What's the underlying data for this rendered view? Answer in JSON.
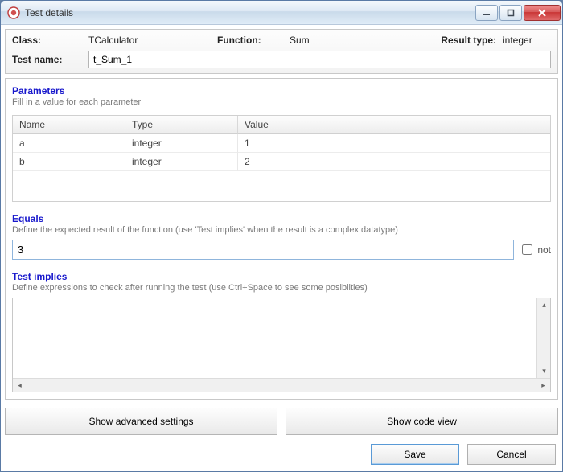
{
  "window": {
    "title": "Test details"
  },
  "header": {
    "class_label": "Class:",
    "class_value": "TCalculator",
    "function_label": "Function:",
    "function_value": "Sum",
    "result_type_label": "Result type:",
    "result_type_value": "integer",
    "test_name_label": "Test name:",
    "test_name_value": "t_Sum_1"
  },
  "parameters": {
    "title": "Parameters",
    "subtitle": "Fill in a value for each parameter",
    "columns": {
      "name": "Name",
      "type": "Type",
      "value": "Value"
    },
    "rows": [
      {
        "name": "a",
        "type": "integer",
        "value": "1"
      },
      {
        "name": "b",
        "type": "integer",
        "value": "2"
      }
    ]
  },
  "equals": {
    "title": "Equals",
    "subtitle": "Define the expected result of the function  (use 'Test implies' when the result is a complex datatype)",
    "value": "3",
    "not_label": "not",
    "not_checked": false
  },
  "implies": {
    "title": "Test implies",
    "subtitle": "Define expressions to check after running the test  (use Ctrl+Space to see some posibilties)",
    "value": ""
  },
  "buttons": {
    "advanced": "Show advanced settings",
    "codeview": "Show code view",
    "save": "Save",
    "cancel": "Cancel"
  }
}
